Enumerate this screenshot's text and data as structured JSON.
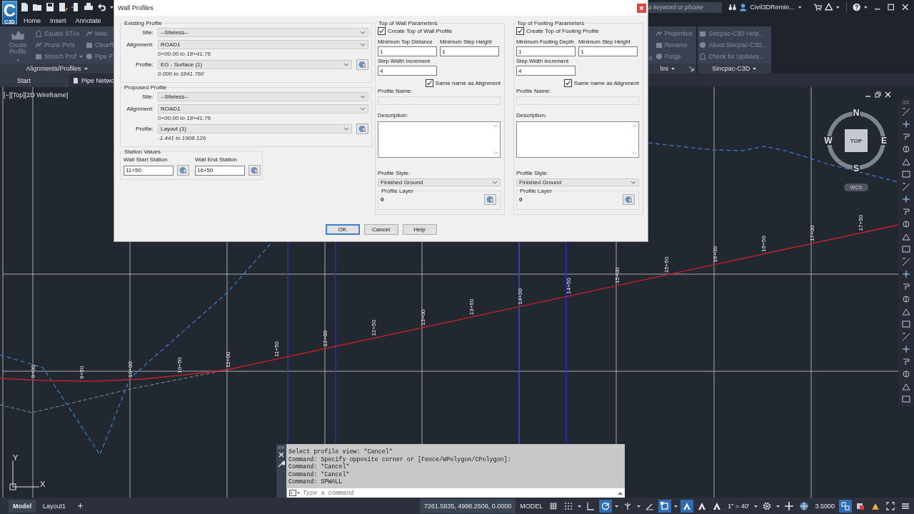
{
  "app": {
    "letter": "C",
    "badge": "C3D"
  },
  "ribbon": {
    "tabs": [
      {
        "label": "Home"
      },
      {
        "label": "Insert"
      },
      {
        "label": "Annotate"
      }
    ],
    "search": {
      "placeholder": "a keyword or phrase"
    },
    "account": {
      "name": "Civil3DRemin..."
    },
    "left_panel": {
      "big_button": "Create Profile",
      "columns": [
        [
          {
            "label": "Equate STAs",
            "dropdown": false
          },
          {
            "label": "Prune PVIs",
            "dropdown": false
          },
          {
            "label": "Stretch Prof",
            "dropdown": true
          }
        ],
        [
          {
            "label": "Matc",
            "dropdown": false
          },
          {
            "label": "ClearR",
            "dropdown": false
          },
          {
            "label": "Pipe P",
            "dropdown": false
          }
        ]
      ],
      "title": "Alignments/Profiles"
    },
    "right_panels": [
      {
        "title": "les",
        "fragment": "e",
        "launcher": true,
        "items": [
          "Properties",
          "Rename",
          "Purge"
        ]
      },
      {
        "title": "Sincpac-C3D",
        "launcher": false,
        "items": [
          "Sincpac-C3D Help...",
          "About Sincpac-C3D...",
          "Check for Updates..."
        ]
      }
    ]
  },
  "file_tabs": [
    {
      "label": "Start"
    },
    {
      "label": "Pipe Netwo"
    }
  ],
  "viewport": {
    "controls": [
      "[−]",
      "[Top]",
      "[2D Wireframe]"
    ],
    "viewcube": {
      "north": "N",
      "south": "S",
      "east": "E",
      "west": "W",
      "top": "TOP",
      "ucs": "WCS"
    },
    "stations": [
      "9+00",
      "9+50",
      "10+00",
      "10+50",
      "11+00",
      "11+50",
      "12+00",
      "12+50",
      "13+00",
      "13+50",
      "14+00",
      "14+50",
      "15+00",
      "15+50",
      "16+00",
      "16+50",
      "17+00",
      "17+50"
    ],
    "axes": {
      "x": "X",
      "y": "Y"
    }
  },
  "dialog": {
    "title": "Wall Profiles",
    "existing_profile": {
      "title": "Existing Profile",
      "rows": [
        {
          "label": "Site:",
          "value": "--Siteless--",
          "pick": false
        },
        {
          "label": "Alignment:",
          "value": "ROAD1",
          "range": "0+00.00 to 18+41.76",
          "pick": false
        },
        {
          "label": "Profile:",
          "value": "EG - Surface (1)",
          "range": "0.000 to 1841.760",
          "pick": true
        }
      ]
    },
    "proposed_profile": {
      "title": "Proposed Profile",
      "rows": [
        {
          "label": "Site:",
          "value": "--Siteless--",
          "pick": false
        },
        {
          "label": "Alignment:",
          "value": "ROAD1",
          "range": "0+00.00 to 18+41.76",
          "pick": false
        },
        {
          "label": "Profile:",
          "value": "Layout (1)",
          "range": "-1.441 to 1908.126",
          "pick": true
        }
      ]
    },
    "station_values": {
      "title": "Station Values",
      "fields": [
        {
          "label": "Wall Start Station",
          "value": "11+50"
        },
        {
          "label": "Wall End Station",
          "value": "16+50"
        }
      ]
    },
    "wall": {
      "title": "Top of Wall Parameters",
      "create": {
        "label": "Create Top of Wall Profile",
        "checked": true
      },
      "fields": [
        {
          "label": "Minimum Top Distance",
          "value": "1"
        },
        {
          "label": "Minimum Step Height",
          "value": "1"
        },
        {
          "label": "Step Width Increment",
          "value": "4"
        }
      ],
      "same_name": {
        "label": "Same name as Alignment",
        "checked": true
      },
      "profile_name": {
        "label": "Profile Name:",
        "disabled": true
      },
      "description": {
        "label": "Description:"
      },
      "style": {
        "label": "Profile Style:",
        "value": "Finished Ground"
      },
      "layer": {
        "title": "Profile Layer",
        "value": "0"
      }
    },
    "footing": {
      "title": "Top of Footing Parameters",
      "create": {
        "label": "Create Top of Footing Profile",
        "checked": true
      },
      "fields": [
        {
          "label": "Minimum Footing Depth",
          "value": "1"
        },
        {
          "label": "Minimum Step Height",
          "value": "1"
        },
        {
          "label": "Step Width Increment",
          "value": "4"
        }
      ],
      "same_name": {
        "label": "Same name as Alignment",
        "checked": true
      },
      "profile_name": {
        "label": "Profile Name:",
        "disabled": true
      },
      "description": {
        "label": "Description:"
      },
      "style": {
        "label": "Profile Style:",
        "value": "Finished Ground"
      },
      "layer": {
        "title": "Profile Layer",
        "value": "0"
      }
    },
    "buttons": [
      {
        "label": "OK",
        "default": true
      },
      {
        "label": "Cancel",
        "default": false
      },
      {
        "label": "Help",
        "default": false
      }
    ]
  },
  "command_line": {
    "history": [
      "Select profile view: *Cancel*",
      "Command: Specify opposite corner or [Fence/WPolygon/CPolygon]:",
      "Command: *Cancel*",
      "Command: *Cancel*",
      "Command: SPWALL"
    ],
    "placeholder": "Type a command"
  },
  "layout_tabs": [
    {
      "label": "Model",
      "selected": true
    },
    {
      "label": "Layout1",
      "selected": false
    }
  ],
  "status_items": [
    {
      "kind": "readout",
      "text": "7261.5835, 4998.2508, 0.0000"
    },
    {
      "kind": "label",
      "text": "MODEL"
    },
    {
      "kind": "grid",
      "on": false
    },
    {
      "kind": "snap",
      "on": false
    },
    {
      "kind": "caret"
    },
    {
      "kind": "ortho",
      "on": false
    },
    {
      "kind": "polar",
      "on": true
    },
    {
      "kind": "caret"
    },
    {
      "kind": "isodraft",
      "on": false
    },
    {
      "kind": "caret"
    },
    {
      "kind": "angle",
      "on": false
    },
    {
      "kind": "osnap",
      "on": true
    },
    {
      "kind": "caret"
    },
    {
      "kind": "annotation",
      "on": true
    },
    {
      "kind": "annotation",
      "on": false
    },
    {
      "kind": "annotation",
      "on": false
    },
    {
      "kind": "label",
      "text": "1\" = 40'"
    },
    {
      "kind": "caret"
    },
    {
      "kind": "gear"
    },
    {
      "kind": "caret"
    },
    {
      "kind": "plus"
    },
    {
      "kind": "globe"
    },
    {
      "kind": "label",
      "text": "3.5000"
    },
    {
      "kind": "panes",
      "on": true
    },
    {
      "kind": "layers"
    },
    {
      "kind": "isolate"
    },
    {
      "kind": "fullscreen"
    },
    {
      "kind": "menu"
    }
  ]
}
